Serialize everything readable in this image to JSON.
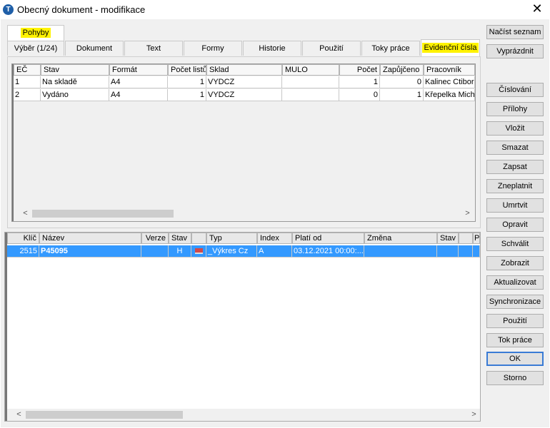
{
  "window": {
    "title": "Obecný dokument - modifikace"
  },
  "tabs_top": {
    "pohyby": "Pohyby"
  },
  "tabs": {
    "vyber": "Výběr (1/24)",
    "dokument": "Dokument",
    "text": "Text",
    "formy": "Formy",
    "historie": "Historie",
    "pouziti": "Použití",
    "toky": "Toky práce",
    "evidencni": "Evidenční čísla"
  },
  "upper_grid": {
    "headers": [
      "EČ",
      "Stav",
      "Formát",
      "Počet listů",
      "Sklad",
      "MULO",
      "Počet",
      "Zapůjčeno",
      "Pracovník"
    ],
    "rows": [
      [
        "1",
        "Na skladě",
        "A4",
        "1",
        "VYDCZ",
        "",
        "1",
        "0",
        "Kalinec Ctibor"
      ],
      [
        "2",
        "Vydáno",
        "A4",
        "1",
        "VYDCZ",
        "",
        "0",
        "1",
        "Křepelka Micha"
      ]
    ]
  },
  "lower_grid": {
    "headers": [
      "Klíč",
      "Název",
      "Verze",
      "Stav",
      "",
      "Typ",
      "Index",
      "Platí od",
      "Změna",
      "Stav",
      "",
      "P"
    ],
    "rows": [
      [
        "2515",
        "P45095",
        "",
        "H",
        "",
        "_Výkres Cz",
        "A",
        "03.12.2021 00:00:...",
        "",
        "",
        "",
        ""
      ]
    ]
  },
  "buttons": {
    "nacist": "Načíst seznam",
    "vyprazdnit": "Vyprázdnit",
    "cislovani": "Číslování",
    "prilohy": "Přílohy",
    "vlozit": "Vložit",
    "smazat": "Smazat",
    "zapsat": "Zapsat",
    "zneplatnit": "Zneplatnit",
    "umrtvit": "Umrtvit",
    "opravit": "Opravit",
    "schvalit": "Schválit",
    "zobrazit": "Zobrazit",
    "aktualizovat": "Aktualizovat",
    "synchronizace": "Synchronizace",
    "pouziti": "Použití",
    "tok": "Tok práce",
    "ok": "OK",
    "storno": "Storno"
  },
  "colors": {
    "highlight": "#fff200",
    "selection": "#3399ff"
  }
}
